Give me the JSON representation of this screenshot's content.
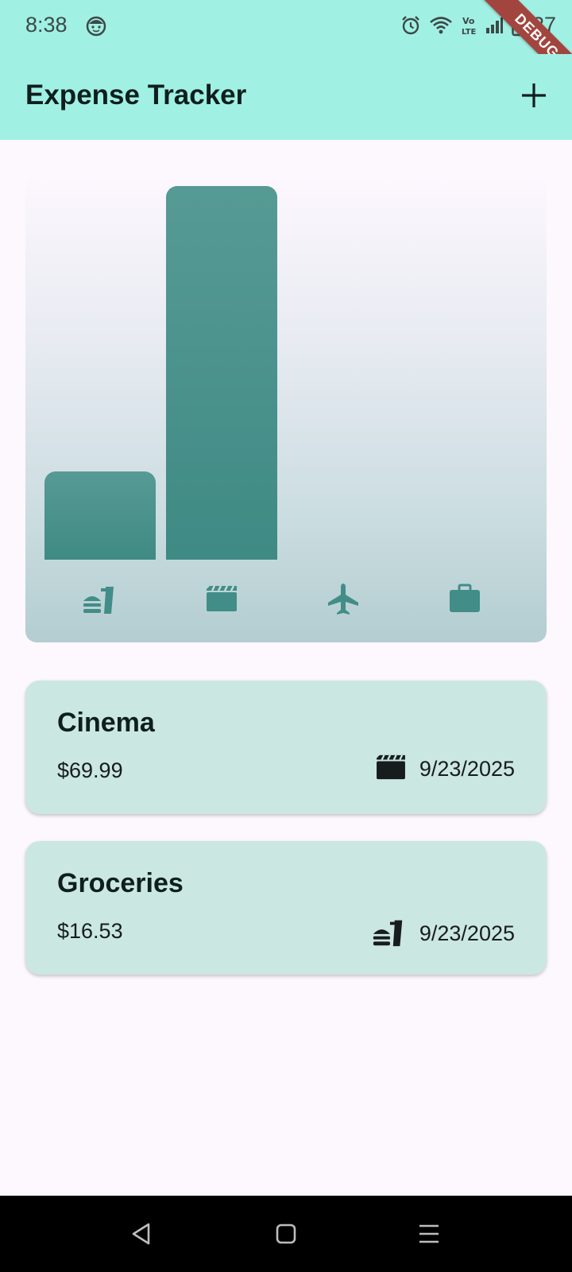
{
  "status_bar": {
    "time": "8:38",
    "battery": "27",
    "icons": [
      "face-icon",
      "alarm-icon",
      "wifi-icon",
      "volte-icon",
      "signal-icon",
      "battery-charging-icon"
    ]
  },
  "debug_banner": "DEBUG",
  "app_bar": {
    "title": "Expense Tracker",
    "action_icon": "add-icon"
  },
  "chart_data": {
    "type": "bar",
    "categories": [
      "food",
      "leisure",
      "travel",
      "work"
    ],
    "category_icons": [
      "fastfood-icon",
      "movie-icon",
      "flight-icon",
      "work-icon"
    ],
    "values": [
      16.53,
      69.99,
      0,
      0
    ],
    "ylim": [
      0,
      69.99
    ],
    "bar_color": "#428D87"
  },
  "expenses": [
    {
      "title": "Cinema",
      "amount": "$69.99",
      "category_icon": "movie-icon",
      "date": "9/23/2025"
    },
    {
      "title": "Groceries",
      "amount": "$16.53",
      "category_icon": "fastfood-icon",
      "date": "9/23/2025"
    }
  ],
  "nav_bar": {
    "buttons": [
      "back-icon",
      "home-icon",
      "recents-icon"
    ]
  },
  "colors": {
    "app_bar": "#A1F0E4",
    "background": "#FDF7FE",
    "card": "#CBE7E2",
    "accent": "#428D87"
  }
}
